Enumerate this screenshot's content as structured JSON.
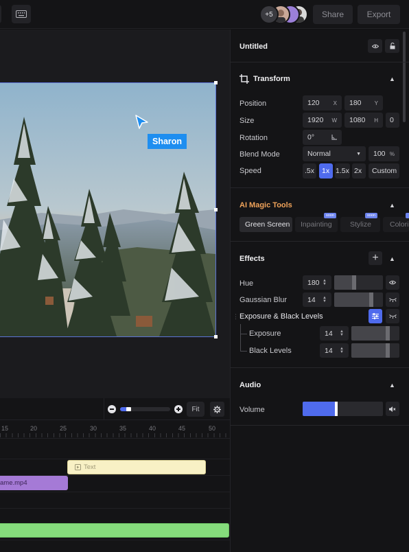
{
  "header": {
    "extra_users": "+5",
    "share_label": "Share",
    "export_label": "Export"
  },
  "canvas": {
    "cursor_user": "Sharon"
  },
  "panel": {
    "title": "Untitled",
    "transform": {
      "title": "Transform",
      "position_label": "Position",
      "position_x": "120",
      "position_y": "180",
      "x_unit": "X",
      "y_unit": "Y",
      "size_label": "Size",
      "size_w": "1920",
      "size_h": "1080",
      "w_unit": "W",
      "h_unit": "H",
      "size_extra": "0",
      "rotation_label": "Rotation",
      "rotation_value": "0°",
      "blend_label": "Blend Mode",
      "blend_value": "Normal",
      "opacity_value": "100",
      "opacity_unit": "%",
      "speed_label": "Speed",
      "speed_options": [
        ".5x",
        "1x",
        "1.5x",
        "2x",
        "Custom"
      ],
      "speed_selected": "1x"
    },
    "ai_tools": {
      "title": "AI Magic Tools",
      "items": [
        "Green Screen",
        "Inpainting",
        "Stylize",
        "Colori"
      ],
      "soon_badge": "soon"
    },
    "effects": {
      "title": "Effects",
      "hue_label": "Hue",
      "hue_value": "180",
      "hue_level": 0.45,
      "blur_label": "Gaussian Blur",
      "blur_value": "14",
      "blur_level": 0.8,
      "exposure_group_label": "Exposure & Black Levels",
      "exposure_label": "Exposure",
      "exposure_value": "14",
      "exposure_level": 0.8,
      "black_label": "Black Levels",
      "black_value": "14",
      "black_level": 0.8
    },
    "audio": {
      "title": "Audio",
      "volume_label": "Volume",
      "volume_level": 0.44
    }
  },
  "timeline": {
    "fit_label": "Fit",
    "ruler": [
      "15",
      "20",
      "25",
      "30",
      "35",
      "40",
      "45",
      "50"
    ],
    "text_clip": "Text",
    "video_clip": "ame.mp4"
  },
  "colors": {
    "accent": "#4f6bed",
    "ai_title": "#f0a35a",
    "text_clip": "#f8f1c5",
    "video_clip": "#a57ad6",
    "audio_clip": "#85dc7c"
  }
}
